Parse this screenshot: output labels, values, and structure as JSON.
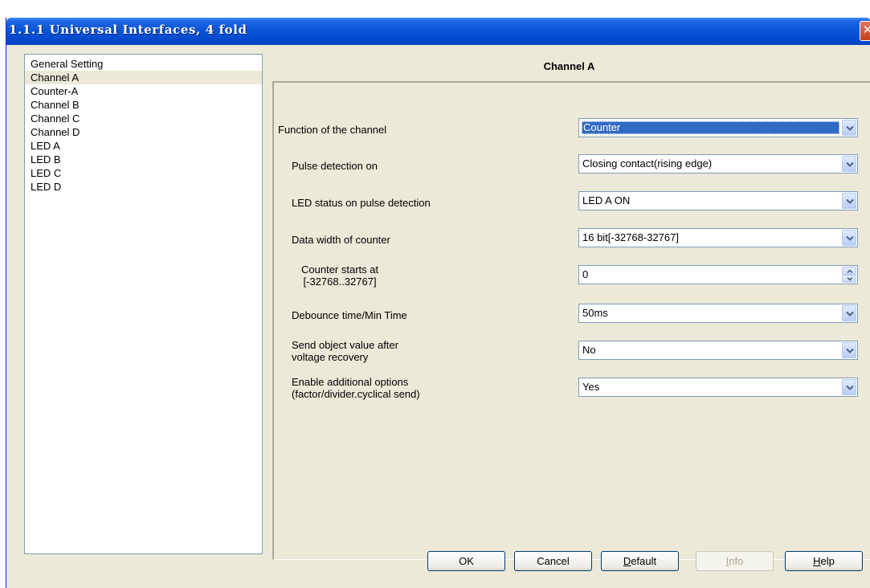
{
  "window": {
    "title": "1.1.1 Universal Interfaces, 4 fold",
    "close_glyph": "✕"
  },
  "sidebar": {
    "items": [
      {
        "label": "General Setting",
        "selected": false
      },
      {
        "label": "Channel A",
        "selected": true
      },
      {
        "label": "Counter-A",
        "selected": false
      },
      {
        "label": "Channel B",
        "selected": false
      },
      {
        "label": "Channel C",
        "selected": false
      },
      {
        "label": "Channel D",
        "selected": false
      },
      {
        "label": "LED A",
        "selected": false
      },
      {
        "label": "LED B",
        "selected": false
      },
      {
        "label": "LED C",
        "selected": false
      },
      {
        "label": "LED D",
        "selected": false
      }
    ]
  },
  "panel": {
    "title": "Channel A",
    "rows": [
      {
        "label_lines": [
          "Function of the channel"
        ],
        "value": "Counter",
        "control": "dropdown",
        "focused": true
      },
      {
        "label_lines": [
          "Pulse detection on"
        ],
        "value": "Closing contact(rising edge)",
        "control": "dropdown"
      },
      {
        "label_lines": [
          "LED status on pulse detection"
        ],
        "value": "LED A ON",
        "control": "dropdown"
      },
      {
        "label_lines": [
          "Data width of counter"
        ],
        "value": "16 bit[-32768-32767]",
        "control": "dropdown"
      },
      {
        "label_lines": [
          "Counter starts at",
          "[-32768..32767]"
        ],
        "value": "0",
        "control": "spinner"
      },
      {
        "label_lines": [
          "Debounce time/Min Time"
        ],
        "value": "50ms",
        "control": "dropdown"
      },
      {
        "label_lines": [
          "Send object value after",
          "voltage recovery"
        ],
        "value": "No",
        "control": "dropdown"
      },
      {
        "label_lines": [
          "Enable additional options",
          "(factor/divider.cyclical send)"
        ],
        "value": "Yes",
        "control": "dropdown"
      }
    ]
  },
  "buttons": {
    "ok": "OK",
    "cancel": "Cancel",
    "default_first": "D",
    "default_rest": "efault",
    "info_first": "I",
    "info_rest": "nfo",
    "help_first": "H",
    "help_rest": "elp"
  },
  "colors": {
    "title_bar": "#0a55d7",
    "selection": "#316ac5",
    "dialog_bg": "#ece9d8"
  },
  "icons": {
    "close": "close-icon",
    "dropdown": "chevron-down-icon",
    "spinner_up": "arrow-up-icon",
    "spinner_down": "arrow-down-icon"
  }
}
